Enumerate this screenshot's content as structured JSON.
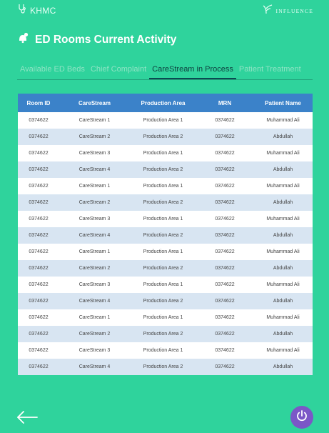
{
  "header": {
    "brand_left": "KHMC",
    "brand_right": "INFLUENCE",
    "page_title": "ED Rooms Current Activity"
  },
  "tabs": [
    {
      "label": "Available ED Beds",
      "active": false
    },
    {
      "label": "Chief Complaint",
      "active": false
    },
    {
      "label": "CareStream in Process",
      "active": true
    },
    {
      "label": "Patient Treatment",
      "active": false
    }
  ],
  "table": {
    "columns": [
      "Room ID",
      "CareStream",
      "Production Area",
      "MRN",
      "Patient Name"
    ],
    "rows": [
      [
        "0374622",
        "CareStream 1",
        "Production Area 1",
        "0374622",
        "Muhammad Ali"
      ],
      [
        "0374622",
        "CareStream 2",
        "Production Area 2",
        "0374622",
        "Abdullah"
      ],
      [
        "0374622",
        "CareStream 3",
        "Production Area 1",
        "0374622",
        "Muhammad Ali"
      ],
      [
        "0374622",
        "CareStream 4",
        "Production Area 2",
        "0374622",
        "Abdullah"
      ],
      [
        "0374622",
        "CareStream 1",
        "Production Area 1",
        "0374622",
        "Muhammad Ali"
      ],
      [
        "0374622",
        "CareStream 2",
        "Production Area 2",
        "0374622",
        "Abdullah"
      ],
      [
        "0374622",
        "CareStream 3",
        "Production Area 1",
        "0374622",
        "Muhammad Ali"
      ],
      [
        "0374622",
        "CareStream 4",
        "Production Area 2",
        "0374622",
        "Abdullah"
      ],
      [
        "0374622",
        "CareStream 1",
        "Production Area 1",
        "0374622",
        "Muhammad Ali"
      ],
      [
        "0374622",
        "CareStream 2",
        "Production Area 2",
        "0374622",
        "Abdullah"
      ],
      [
        "0374622",
        "CareStream 3",
        "Production Area 1",
        "0374622",
        "Muhammad Ali"
      ],
      [
        "0374622",
        "CareStream 4",
        "Production Area 2",
        "0374622",
        "Abdullah"
      ],
      [
        "0374622",
        "CareStream 1",
        "Production Area 1",
        "0374622",
        "Muhammad Ali"
      ],
      [
        "0374622",
        "CareStream 2",
        "Production Area 2",
        "0374622",
        "Abdullah"
      ],
      [
        "0374622",
        "CareStream 3",
        "Production Area 1",
        "0374622",
        "Muhammad Ali"
      ],
      [
        "0374622",
        "CareStream 4",
        "Production Area 2",
        "0374622",
        "Abdullah"
      ]
    ]
  },
  "icons": {
    "brand_left": "stethoscope-icon",
    "brand_right": "influence-logo-icon",
    "title": "user-bell-icon",
    "back": "arrow-left-icon",
    "power": "power-icon"
  },
  "colors": {
    "background": "#2fd39c",
    "table_header": "#3b82c9",
    "row_alt": "#d8e5f2",
    "active_tab": "#0f3f3f",
    "power_button": "#7b57c7"
  }
}
